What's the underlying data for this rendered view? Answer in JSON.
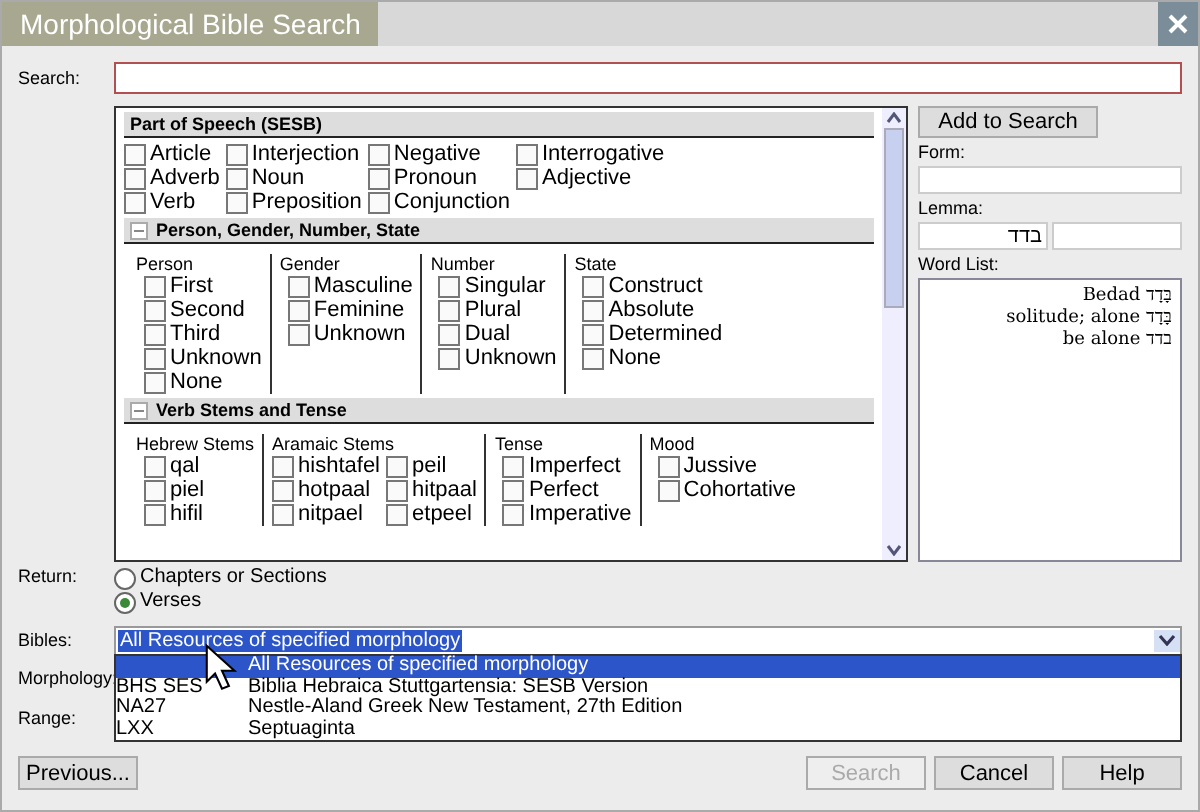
{
  "window": {
    "title": "Morphological Bible Search"
  },
  "search": {
    "label": "Search:"
  },
  "sections": [
    {
      "title": "Part of Speech (SESB)",
      "kind": "grid",
      "options": [
        {
          "label": "Article",
          "checked": false
        },
        {
          "label": "Interjection",
          "checked": false
        },
        {
          "label": "Negative",
          "checked": false
        },
        {
          "label": "Interrogative",
          "checked": false
        },
        {
          "label": "Adverb",
          "checked": false
        },
        {
          "label": "Noun",
          "checked": false
        },
        {
          "label": "Pronoun",
          "checked": false
        },
        {
          "label": "Adjective",
          "checked": false
        },
        {
          "label": "Verb",
          "checked": false
        },
        {
          "label": "Preposition",
          "checked": false
        },
        {
          "label": "Conjunction",
          "checked": false
        }
      ]
    },
    {
      "title": "Person, Gender, Number, State",
      "kind": "columns",
      "expanded": true,
      "columns": [
        {
          "heading": "Person",
          "kind": "single",
          "options": [
            {
              "label": "First",
              "checked": false
            },
            {
              "label": "Second",
              "checked": false
            },
            {
              "label": "Third",
              "checked": false
            },
            {
              "label": "Unknown",
              "checked": false
            },
            {
              "label": "None",
              "checked": false
            }
          ]
        },
        {
          "heading": "Gender",
          "kind": "single",
          "options": [
            {
              "label": "Masculine",
              "checked": false
            },
            {
              "label": "Feminine",
              "checked": false
            },
            {
              "label": "Unknown",
              "checked": false
            }
          ]
        },
        {
          "heading": "Number",
          "kind": "single",
          "options": [
            {
              "label": "Singular",
              "checked": false
            },
            {
              "label": "Plural",
              "checked": false
            },
            {
              "label": "Dual",
              "checked": false
            },
            {
              "label": "Unknown",
              "checked": false
            }
          ]
        },
        {
          "heading": "State",
          "kind": "single",
          "options": [
            {
              "label": "Construct",
              "checked": false
            },
            {
              "label": "Absolute",
              "checked": false
            },
            {
              "label": "Determined",
              "checked": false
            },
            {
              "label": "None",
              "checked": false
            }
          ]
        }
      ]
    },
    {
      "title": "Verb Stems and Tense",
      "kind": "columns",
      "expanded": true,
      "columns": [
        {
          "heading": "Hebrew Stems",
          "kind": "single",
          "options": [
            {
              "label": "qal",
              "checked": false
            },
            {
              "label": "piel",
              "checked": false
            },
            {
              "label": "hifil",
              "checked": false
            }
          ]
        },
        {
          "heading": "Aramaic Stems",
          "kind": "double",
          "options": [
            {
              "label": "hishtafel",
              "checked": false
            },
            {
              "label": "peil",
              "checked": false
            },
            {
              "label": "hotpaal",
              "checked": false
            },
            {
              "label": "hitpaal",
              "checked": false
            },
            {
              "label": "nitpael",
              "checked": false
            },
            {
              "label": "etpeel",
              "checked": false
            }
          ]
        },
        {
          "heading": "Tense",
          "kind": "single",
          "options": [
            {
              "label": "Imperfect",
              "checked": false
            },
            {
              "label": "Perfect",
              "checked": false
            },
            {
              "label": "Imperative",
              "checked": false
            }
          ]
        },
        {
          "heading": "Mood",
          "kind": "single",
          "options": [
            {
              "label": "Jussive",
              "checked": false
            },
            {
              "label": "Cohortative",
              "checked": false
            }
          ]
        }
      ]
    }
  ],
  "add_button": "Add to Search",
  "form": {
    "label": "Form:"
  },
  "lemma": {
    "label": "Lemma:",
    "value": "בדד"
  },
  "word_list": {
    "label": "Word List:",
    "items": [
      {
        "text": "בָּדָד Bedad"
      },
      {
        "text": "בָּדָד solitude; alone"
      },
      {
        "text": "בדד be alone"
      }
    ]
  },
  "return": {
    "label": "Return:",
    "options": [
      {
        "label": "Chapters or Sections",
        "selected": false
      },
      {
        "label": "Verses",
        "selected": true
      }
    ]
  },
  "bibles": {
    "label": "Bibles:",
    "value": "All Resources of specified morphology",
    "expanded": true,
    "options": [
      {
        "title": "All Resources of specified morphology",
        "selected": true
      },
      {
        "abbr": "BHS SES",
        "title": "Biblia Hebraica Stuttgartensia: SESB Version",
        "selected": false
      },
      {
        "abbr": "NA27",
        "title": "Nestle-Aland Greek New Testament, 27th Edition",
        "selected": false
      },
      {
        "abbr": "LXX",
        "title": "Septuaginta",
        "selected": false
      }
    ]
  },
  "morphology": {
    "label": "Morphology:"
  },
  "range": {
    "label": "Range:"
  },
  "buttons": [
    {
      "label": "Previous...",
      "disabled": false
    },
    {
      "label": "Search",
      "disabled": true
    },
    {
      "label": "Cancel",
      "disabled": false
    },
    {
      "label": "Help",
      "disabled": false
    }
  ]
}
